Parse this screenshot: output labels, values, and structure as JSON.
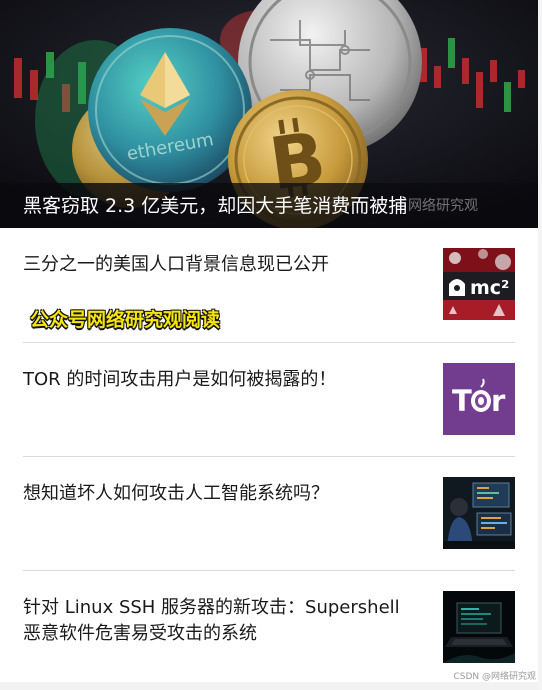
{
  "hero": {
    "title": "黑客窃取 2.3 亿美元，却因大手笔消费而被捕",
    "watermark": "网络研究观",
    "coin_text": "ethereum"
  },
  "articles": [
    {
      "title": "三分之一的美国人口背景信息现已公开",
      "thumb_text": "mc²",
      "thumb_icon": "hooded-figure-icon"
    },
    {
      "title": "TOR 的时间攻击用户是如何被揭露的！",
      "thumb_text": "Tor",
      "thumb_icon": "onion-icon"
    },
    {
      "title": "想知道坏人如何攻击人工智能系统吗？",
      "thumb_icon": "hacker-monitors-icon"
    },
    {
      "title": "针对 Linux SSH 服务器的新攻击：Supershell 恶意软件危害易受攻击的系统",
      "thumb_icon": "terminal-laptop-icon"
    }
  ],
  "promo": "公众号网络研究观阅读",
  "footer_mark": "CSDN @网络研究观",
  "colors": {
    "promo_yellow": "#f7e60a",
    "tor_purple": "#7d4698",
    "mc_red": "#c3202c"
  }
}
